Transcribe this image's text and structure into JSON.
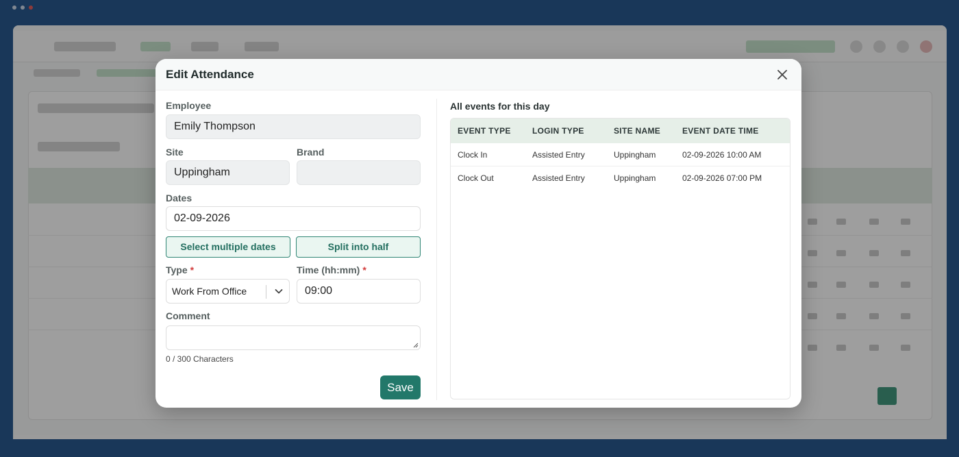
{
  "modal": {
    "title": "Edit Attendance",
    "close_icon": "close-icon"
  },
  "form": {
    "employee": {
      "label": "Employee",
      "value": "Emily Thompson"
    },
    "site": {
      "label": "Site",
      "value": "Uppingham"
    },
    "brand": {
      "label": "Brand",
      "value": ""
    },
    "dates": {
      "label": "Dates",
      "value": "02-09-2026"
    },
    "select_multiple_label": "Select multiple dates",
    "split_half_label": "Split into half",
    "type": {
      "label": "Type",
      "required_mark": "*",
      "value": "Work From Office",
      "icon": "chevron-down-icon"
    },
    "time": {
      "label": "Time (hh:mm)",
      "required_mark": "*",
      "value": "09:00"
    },
    "comment": {
      "label": "Comment",
      "value": "",
      "char_count": "0 / 300 Characters"
    },
    "save_label": "Save"
  },
  "events": {
    "title": "All events for this day",
    "columns": [
      "EVENT TYPE",
      "LOGIN TYPE",
      "SITE NAME",
      "EVENT DATE TIME"
    ],
    "rows": [
      [
        "Clock In",
        "Assisted Entry",
        "Uppingham",
        "02-09-2026 10:00 AM"
      ],
      [
        "Clock Out",
        "Assisted Entry",
        "Uppingham",
        "02-09-2026 07:00 PM"
      ]
    ]
  },
  "colors": {
    "primary": "#22786a",
    "backdrop": "#0d4482",
    "table_header": "#e6efe8",
    "required": "#d23b3b"
  }
}
